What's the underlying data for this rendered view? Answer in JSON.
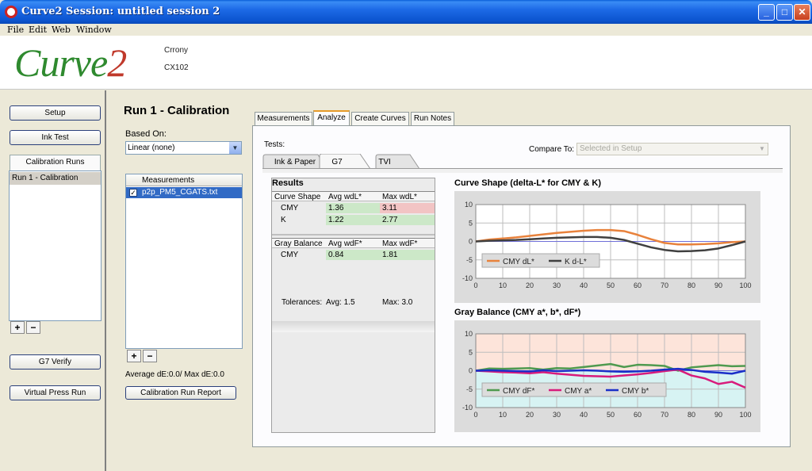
{
  "window": {
    "title": "Curve2 Session: untitled session 2",
    "buttons": [
      "_",
      "□",
      "✕"
    ]
  },
  "menu": {
    "items": [
      "File",
      "Edit",
      "Web",
      "Window"
    ]
  },
  "header": {
    "logo_main": "Curve",
    "logo_accent": "2",
    "line1": "Crrony",
    "line2": "CX102"
  },
  "sidebar": {
    "setup": "Setup",
    "ink_test": "Ink Test",
    "calibration_runs": "Calibration Runs",
    "run_item": "Run 1 - Calibration",
    "add": "+",
    "remove": "−",
    "g7_verify": "G7 Verify",
    "virtual_press_run": "Virtual Press Run"
  },
  "middle": {
    "run_title": "Run 1 - Calibration",
    "based_on_label": "Based On:",
    "based_on_value": "Linear (none)",
    "measurements_header": "Measurements",
    "measurement_file": "p2p_PM5_CGATS.txt",
    "add": "+",
    "remove": "−",
    "avg_de": "Average dE:0.0/ Max dE:0.0",
    "report_button": "Calibration Run Report"
  },
  "tabs": {
    "main": [
      "Measurements",
      "Analyze",
      "Create Curves",
      "Run Notes"
    ],
    "active_main": "Analyze",
    "sub": [
      "Ink & Paper",
      "G7",
      "TVI"
    ],
    "active_sub": "G7"
  },
  "analyze": {
    "tests_label": "Tests:",
    "compare_label": "Compare To:",
    "compare_value": "Selected in Setup"
  },
  "results": {
    "title": "Results",
    "curve_shape": {
      "header": [
        "Curve Shape",
        "Avg wdL*",
        "Max wdL*"
      ],
      "rows": [
        [
          "CMY",
          "1.36",
          "3.11"
        ],
        [
          "K",
          "1.22",
          "2.77"
        ]
      ]
    },
    "gray_balance": {
      "header": [
        "Gray Balance",
        "Avg wdF*",
        "Max wdF*"
      ],
      "rows": [
        [
          "CMY",
          "0.84",
          "1.81"
        ]
      ]
    },
    "tolerances_label": "Tolerances:",
    "tolerances_avg": "Avg: 1.5",
    "tolerances_max": "Max: 3.0"
  },
  "colors": {
    "cmy_dl": "#e8823c",
    "k_dl": "#404040",
    "cmy_df": "#4f9a4f",
    "cmy_a": "#d81b7c",
    "cmy_b": "#1a2fc8",
    "fail": "#f2c4c4",
    "pass": "#cce8c8"
  },
  "chart_data": [
    {
      "type": "line",
      "title": "Curve Shape (delta-L* for CMY & K)",
      "x": [
        0,
        5,
        10,
        15,
        20,
        25,
        30,
        35,
        40,
        45,
        50,
        55,
        60,
        65,
        70,
        75,
        80,
        85,
        90,
        95,
        100
      ],
      "ylim": [
        -10,
        10
      ],
      "yticks": [
        10,
        5,
        0,
        -5,
        -10
      ],
      "xticks": [
        0,
        10,
        20,
        30,
        40,
        50,
        60,
        70,
        80,
        90,
        100
      ],
      "series": [
        {
          "name": "CMY dL*",
          "color": "#e8823c",
          "values": [
            0,
            0.5,
            0.8,
            1.1,
            1.5,
            1.9,
            2.3,
            2.6,
            2.9,
            3.1,
            3.1,
            2.8,
            1.8,
            0.6,
            -0.4,
            -0.8,
            -0.8,
            -0.7,
            -0.5,
            -0.2,
            0
          ]
        },
        {
          "name": "K d-L*",
          "color": "#404040",
          "values": [
            0,
            0.2,
            0.3,
            0.4,
            0.6,
            0.8,
            1.0,
            1.1,
            1.2,
            1.2,
            1.0,
            0.4,
            -0.6,
            -1.6,
            -2.3,
            -2.7,
            -2.6,
            -2.4,
            -1.9,
            -1.0,
            0
          ]
        }
      ],
      "legend": "bottom-left"
    },
    {
      "type": "line",
      "title": "Gray Balance (CMY a*, b*, dF*)",
      "x": [
        0,
        5,
        10,
        15,
        20,
        25,
        30,
        35,
        40,
        45,
        50,
        55,
        60,
        65,
        70,
        75,
        80,
        85,
        90,
        95,
        100
      ],
      "ylim": [
        -10,
        10
      ],
      "yticks": [
        10,
        5,
        0,
        -5,
        -10
      ],
      "xticks": [
        0,
        10,
        20,
        30,
        40,
        50,
        60,
        70,
        80,
        90,
        100
      ],
      "series": [
        {
          "name": "CMY dF*",
          "color": "#4f9a4f",
          "values": [
            0,
            0.6,
            0.5,
            0.6,
            0.7,
            0.3,
            0.7,
            0.6,
            1.0,
            1.4,
            1.8,
            1.0,
            1.6,
            1.5,
            1.3,
            0.0,
            0.9,
            1.2,
            1.5,
            1.2,
            1.3
          ]
        },
        {
          "name": "CMY a*",
          "color": "#d81b7c",
          "values": [
            0,
            -0.2,
            -0.4,
            -0.5,
            -0.7,
            -0.4,
            -0.8,
            -1.1,
            -1.4,
            -1.5,
            -1.6,
            -1.3,
            -1.0,
            -0.6,
            -0.1,
            0.3,
            -1.3,
            -2.1,
            -3.6,
            -3.0,
            -4.6
          ]
        },
        {
          "name": "CMY b*",
          "color": "#1a2fc8",
          "values": [
            0,
            0.1,
            0.0,
            -0.1,
            -0.2,
            0.1,
            -0.1,
            0.0,
            0.1,
            0.0,
            -0.2,
            -0.3,
            -0.2,
            0.0,
            0.3,
            0.5,
            0.2,
            -0.3,
            -0.5,
            -0.8,
            0.0
          ]
        }
      ],
      "legend": "bottom-left"
    }
  ]
}
